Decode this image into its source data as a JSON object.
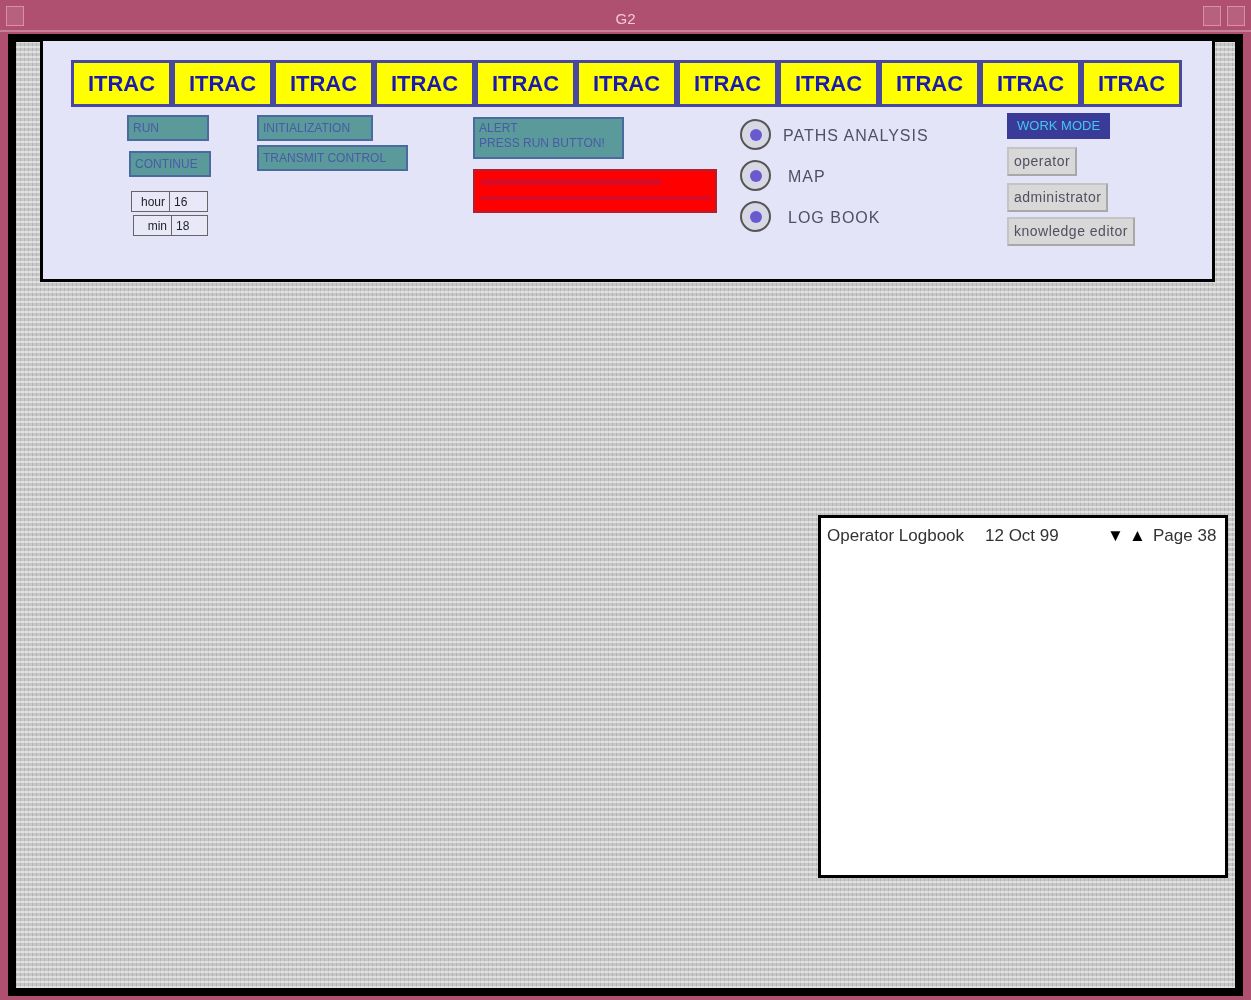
{
  "window": {
    "title": "G2"
  },
  "banner_tabs": [
    "ITRAC",
    "ITRAC",
    "ITRAC",
    "ITRAC",
    "ITRAC",
    "ITRAC",
    "ITRAC",
    "ITRAC",
    "ITRAC",
    "ITRAC",
    "ITRAC"
  ],
  "control_buttons": [
    {
      "label": "RUN"
    },
    {
      "label": "CONTINUE"
    }
  ],
  "clock": [
    {
      "label": "hour",
      "value": "16"
    },
    {
      "label": "min",
      "value": "18"
    }
  ],
  "action_buttons": [
    {
      "label": "INITIALIZATION"
    },
    {
      "label": "TRANSMIT CONTROL"
    }
  ],
  "alert": {
    "lines": [
      "ALERT",
      "PRESS RUN BUTTON!"
    ]
  },
  "views": [
    {
      "label": "PATHS ANALYSIS",
      "selected": true
    },
    {
      "label": "MAP",
      "selected": true
    },
    {
      "label": "LOG BOOK",
      "selected": true
    }
  ],
  "work_mode": {
    "title": "WORK MODE",
    "buttons": [
      "operator",
      "administrator",
      "knowledge editor"
    ]
  },
  "logbook": {
    "title": "Operator Logbook",
    "date": "12 Oct 99",
    "down": "▼",
    "up": "▲",
    "page": "Page 38"
  }
}
